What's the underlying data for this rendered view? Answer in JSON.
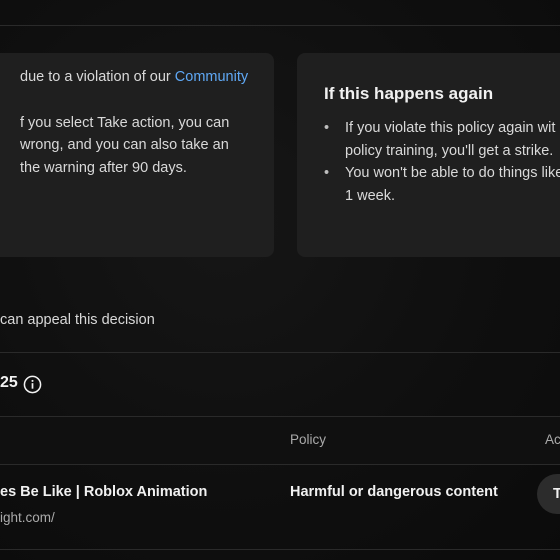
{
  "warning_card": {
    "line1_prefix": "due to a violation of our ",
    "line1_link": "Community",
    "line2": "f you select Take action, you can",
    "line3": "wrong, and you can also take an",
    "line4": "the warning after 90 days."
  },
  "repeat_card": {
    "title": "If this happens again",
    "bullets": [
      {
        "line1": "If you violate this policy again wit",
        "line2": "policy training, you'll get a strike."
      },
      {
        "line1": "You won't be able to do things like",
        "line2": "1 week."
      }
    ]
  },
  "appeal_text": "can appeal this decision",
  "summary": {
    "count_text": "25",
    "info_icon": "info-icon"
  },
  "table": {
    "headers": {
      "policy": "Policy",
      "action": "Ac"
    },
    "rows": [
      {
        "title": "es Be Like | Roblox Animation",
        "subtitle": "ight.com/",
        "policy": "Harmful or dangerous content",
        "action_label": "T"
      }
    ]
  },
  "colors": {
    "background": "#0f0f0f",
    "card": "#1f1f1f",
    "link": "#5fa8f5",
    "muted_text": "#aaaaaa"
  }
}
